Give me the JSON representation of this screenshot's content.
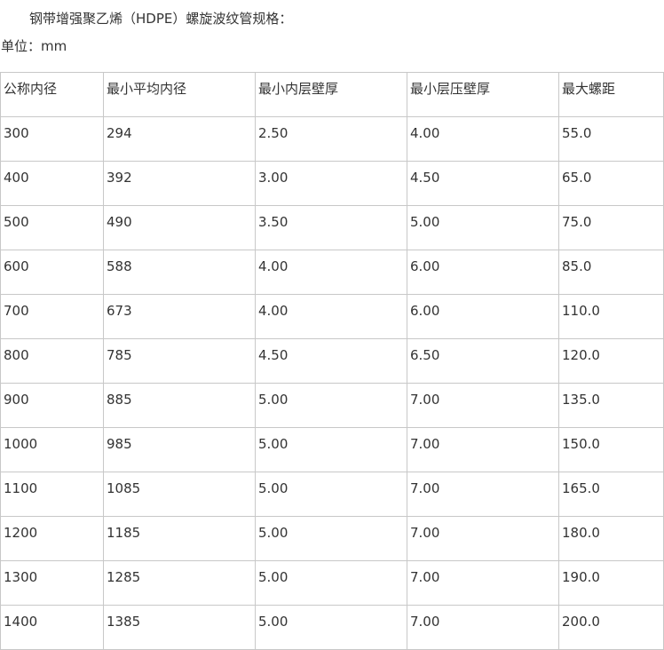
{
  "title": "钢带增强聚乙烯（HDPE）螺旋波纹管规格：",
  "unit_label": "单位：mm",
  "table": {
    "headers": [
      "公称内径",
      "最小平均内径",
      "最小内层壁厚",
      "最小层压壁厚",
      "最大螺距"
    ],
    "rows": [
      [
        "300",
        "294",
        "2.50",
        "4.00",
        "55.0"
      ],
      [
        "400",
        "392",
        "3.00",
        "4.50",
        "65.0"
      ],
      [
        "500",
        "490",
        "3.50",
        "5.00",
        "75.0"
      ],
      [
        "600",
        "588",
        "4.00",
        "6.00",
        "85.0"
      ],
      [
        "700",
        "673",
        "4.00",
        "6.00",
        "110.0"
      ],
      [
        "800",
        "785",
        "4.50",
        "6.50",
        "120.0"
      ],
      [
        "900",
        "885",
        "5.00",
        "7.00",
        "135.0"
      ],
      [
        "1000",
        "985",
        "5.00",
        "7.00",
        "150.0"
      ],
      [
        "1100",
        "1085",
        "5.00",
        "7.00",
        "165.0"
      ],
      [
        "1200",
        "1185",
        "5.00",
        "7.00",
        "180.0"
      ],
      [
        "1300",
        "1285",
        "5.00",
        "7.00",
        "190.0"
      ],
      [
        "1400",
        "1385",
        "5.00",
        "7.00",
        "200.0"
      ]
    ]
  }
}
